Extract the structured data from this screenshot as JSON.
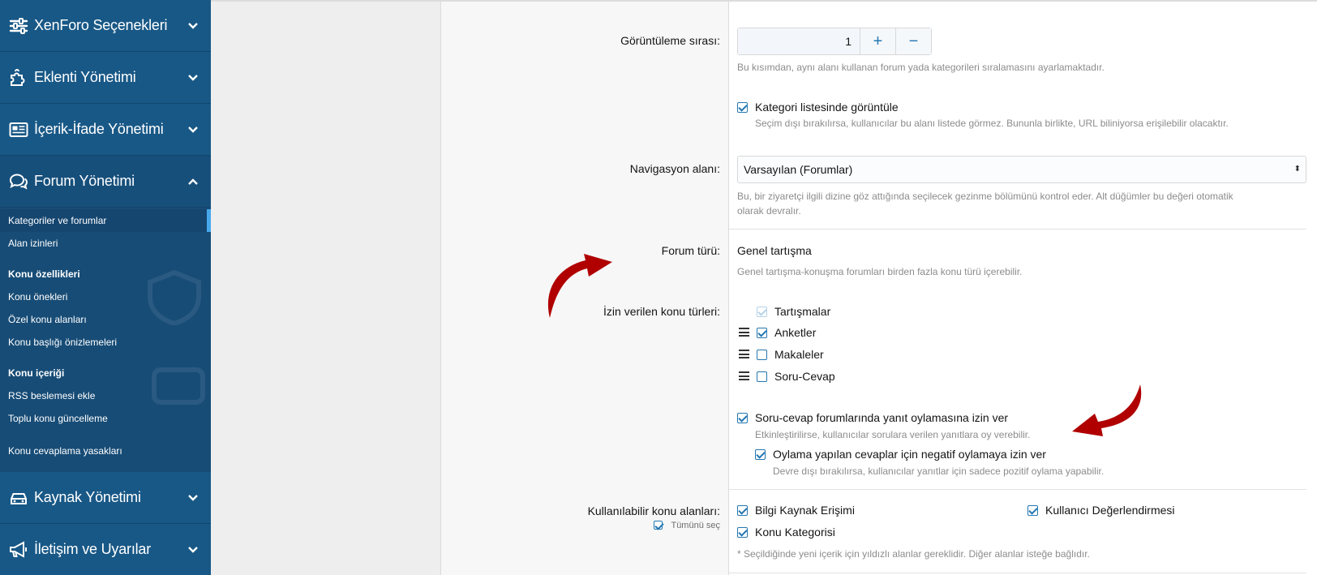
{
  "sidebar": {
    "sections_top": [
      {
        "label": "XenForo Seçenekleri",
        "icon": "sliders-icon"
      },
      {
        "label": "Eklenti Yönetimi",
        "icon": "puzzle-icon"
      },
      {
        "label": "İçerik-İfade Yönetimi",
        "icon": "newspaper-icon"
      },
      {
        "label": "Forum Yönetimi",
        "icon": "comments-icon"
      }
    ],
    "forum_items": {
      "categories": "Kategoriler ve forumlar",
      "permissions": "Alan izinleri",
      "thread_features_head": "Konu özellikleri",
      "prefixes": "Konu önekleri",
      "custom_fields": "Özel konu alanları",
      "title_previews": "Konu başlığı önizlemeleri",
      "thread_content_head": "Konu içeriği",
      "rss": "RSS beslemesi ekle",
      "batch_update": "Toplu konu güncelleme",
      "reply_bans": "Konu cevaplama yasakları"
    },
    "sections_bottom": [
      {
        "label": "Kaynak Yönetimi",
        "icon": "car-icon"
      },
      {
        "label": "İletişim ve Uyarılar",
        "icon": "megaphone-icon"
      }
    ]
  },
  "form": {
    "display_order": {
      "label": "Görüntüleme sırası:",
      "value": "1",
      "plus": "+",
      "minus": "−",
      "hint": "Bu kısımdan, aynı alanı kullanan forum yada kategorileri sıralamasını ayarlamaktadır."
    },
    "list_in_category": {
      "label": "Kategori listesinde görüntüle",
      "hint": "Seçim dışı bırakılırsa, kullanıcılar bu alanı listede görmez. Bununla birlikte, URL biliniyorsa erişilebilir olacaktır."
    },
    "navigation": {
      "label": "Navigasyon alanı:",
      "value": "Varsayılan (Forumlar)",
      "arrow": "⬍",
      "hint_line1": "Bu, bir ziyaretçi ilgili dizine göz attığında seçilecek gezinme bölümünü kontrol eder. Alt düğümler bu değeri otomatik",
      "hint_line2": "olarak devralır."
    },
    "forum_type": {
      "label": "Forum türü:",
      "value": "Genel tartışma",
      "hint": "Genel tartışma-konuşma forumları birden fazla konu türü içerebilir."
    },
    "allowed_types": {
      "label": "İzin verilen konu türleri:",
      "items": [
        "Tartışmalar",
        "Anketler",
        "Makaleler",
        "Soru-Cevap"
      ]
    },
    "qa_voting": {
      "label": "Soru-cevap forumlarında yanıt oylamasına izin ver",
      "hint": "Etkinleştirilirse, kullanıcılar sorulara verilen yanıtlara oy verebilir."
    },
    "negative_voting": {
      "label": "Oylama yapılan cevaplar için negatif oylamaya izin ver",
      "hint": "Devre dışı bırakılırsa, kullanıcılar yanıtlar için sadece pozitif oylama yapabilir."
    },
    "available_fields": {
      "label": "Kullanılabilir konu alanları:",
      "select_all": "Tümünü seç",
      "items": [
        "Bilgi Kaynak Erişimi",
        "Kullanıcı Değerlendirmesi",
        "Konu Kategorisi"
      ],
      "hint": "* Seçildiğinde yeni içerik için yıldızlı alanlar gereklidir. Diğer alanlar isteğe bağlıdır."
    }
  },
  "colors": {
    "sidebar": "#185886",
    "accent": "#2577b1",
    "annotation_arrow": "#b00000"
  }
}
